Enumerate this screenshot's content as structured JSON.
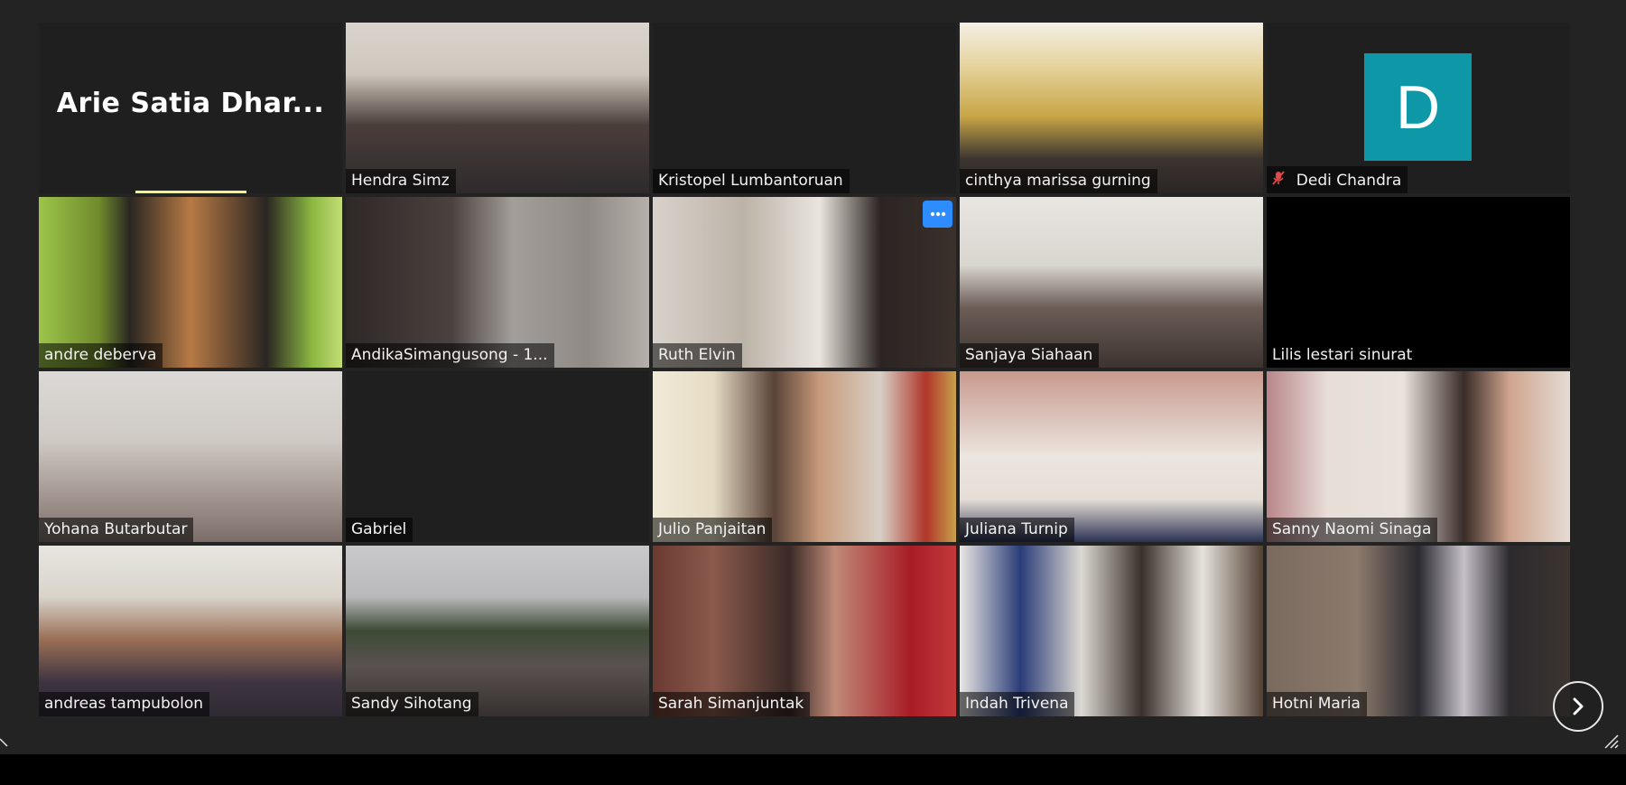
{
  "speaker": {
    "name": "Arie Satia Dhar..."
  },
  "participants": [
    {
      "name": "Hendra Simz"
    },
    {
      "name": "Kristopel Lumbantoruan"
    },
    {
      "name": "cinthya marissa gurning"
    },
    {
      "name": "Dedi Chandra",
      "avatar_letter": "D",
      "avatar_color": "#0e97a6"
    },
    {
      "name": "andre deberva"
    },
    {
      "name": "AndikaSimangusong - 1..."
    },
    {
      "name": "Ruth Elvin",
      "more_icon": "..."
    },
    {
      "name": "Sanjaya Siahaan"
    },
    {
      "name": "Lilis lestari sinurat"
    },
    {
      "name": "Yohana Butarbutar"
    },
    {
      "name": "Gabriel"
    },
    {
      "name": "Julio Panjaitan"
    },
    {
      "name": "Juliana Turnip"
    },
    {
      "name": "Sanny Naomi Sinaga"
    },
    {
      "name": "andreas tampubolon"
    },
    {
      "name": "Sandy Sihotang"
    },
    {
      "name": "Sarah Simanjuntak"
    },
    {
      "name": "Indah Trivena"
    },
    {
      "name": "Hotni Maria"
    }
  ],
  "colors": {
    "active_speaker_outline": "#f2f08a",
    "more_button": "#2d8cff",
    "muted_icon": "#e0484a"
  },
  "icons": {
    "mute": "muted-microphone-icon",
    "next_page": "chevron-right-icon",
    "more": "ellipsis-icon"
  }
}
